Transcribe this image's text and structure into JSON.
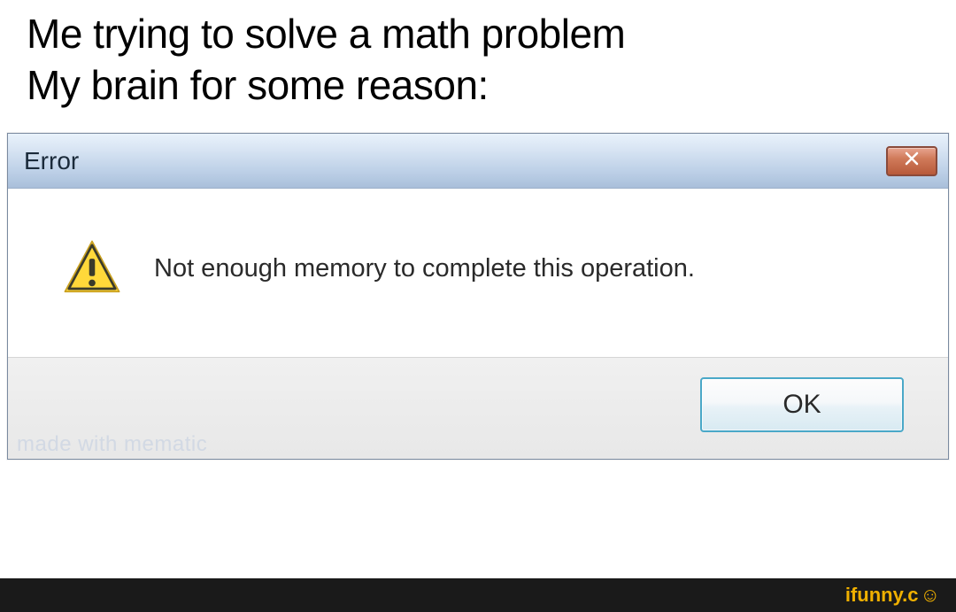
{
  "caption": {
    "line1": "Me trying to solve a math problem",
    "line2": "My brain for some reason:"
  },
  "dialog": {
    "title": "Error",
    "message": "Not enough memory to complete this operation.",
    "ok_label": "OK"
  },
  "watermark": "made with mematic",
  "footer_brand": "ifunny.c"
}
